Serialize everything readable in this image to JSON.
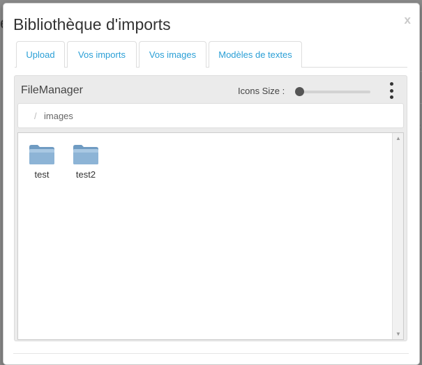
{
  "modal": {
    "title": "Bibliothèque d'imports",
    "close_label": "x"
  },
  "tabs": [
    {
      "label": "Upload"
    },
    {
      "label": "Vos imports"
    },
    {
      "label": "Vos images"
    },
    {
      "label": "Modèles de textes"
    }
  ],
  "file_manager": {
    "title": "FileManager",
    "icons_size_label": "Icons Size :",
    "icons_size_value": 0,
    "breadcrumb": {
      "separator": "/",
      "items": [
        "images"
      ]
    },
    "folders": [
      {
        "name": "test",
        "icon": "folder-icon"
      },
      {
        "name": "test2",
        "icon": "folder-icon"
      }
    ]
  },
  "colors": {
    "accent": "#2a9fd6",
    "folder": "#7aa7cc"
  }
}
